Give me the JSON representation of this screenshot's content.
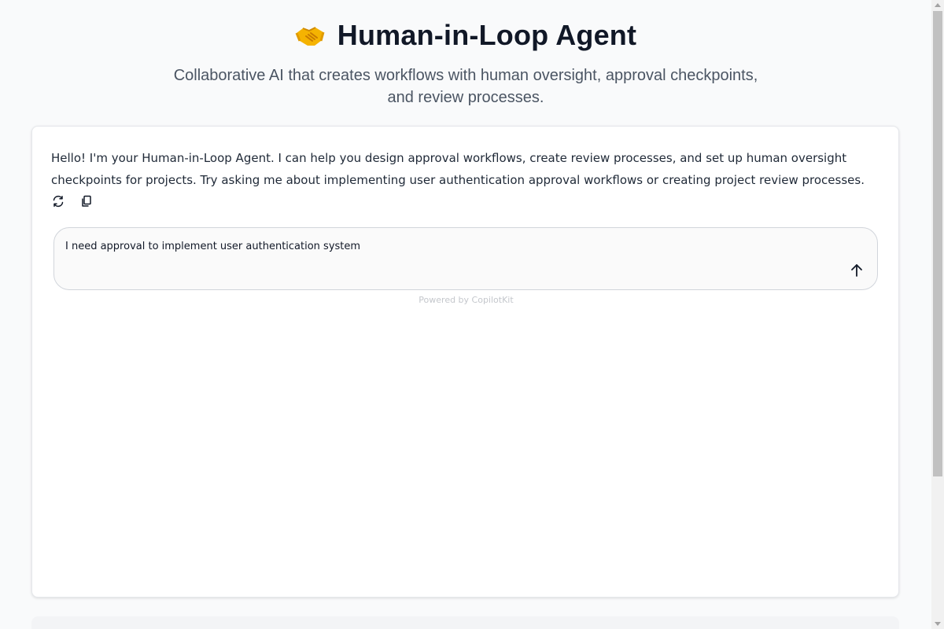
{
  "header": {
    "icon": "handshake-icon",
    "title": "Human-in-Loop Agent",
    "subtitle": "Collaborative AI that creates workflows with human oversight, approval checkpoints, and review processes."
  },
  "chat": {
    "assistant_message": "Hello! I'm your Human-in-Loop Agent. I can help you design approval workflows, create review processes, and set up human oversight checkpoints for projects. Try asking me about implementing user authentication approval workflows or creating project review processes.",
    "actions": [
      {
        "icon": "regenerate-icon"
      },
      {
        "icon": "copy-icon"
      }
    ],
    "input": {
      "value": "I need approval to implement user authentication system"
    },
    "send_icon": "arrow-up-icon",
    "footer": "Powered by CopilotKit"
  },
  "colors": {
    "accent": "#f5b301",
    "text": "#111827",
    "muted": "#4b5563"
  }
}
